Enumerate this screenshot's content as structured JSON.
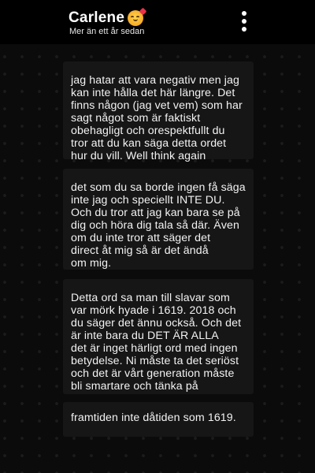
{
  "header": {
    "contact_name": "Carlene",
    "emoji_icon": "smiling-face-with-heart-icon",
    "status": "Mer än ett år sedan",
    "menu_icon": "more-vertical-icon"
  },
  "messages": [
    {
      "text": "jag hatar att vara negativ men jag\nkan inte hålla det här längre. Det\nfinns någon (jag vet vem) som har\nsagt något som är faktiskt\nobehagligt och orespektfullt du\ntror att du kan säga detta ordet\nhur du vill. Well think again"
    },
    {
      "text": "det som du sa borde ingen få säga\ninte jag och speciellt INTE DU.\nOch du tror att jag kan bara se på\ndig och höra dig tala så där. Även\nom du inte tror att säger det\ndirect åt mig så är det ändå\nom mig."
    },
    {
      "text": "Detta ord sa man till slavar som\nvar mörk hyade i 1619. 2018 och\ndu säger det ännu också. Och det\när inte bara du DET ÄR ALLA\ndet är inget härligt ord med ingen\nbetydelse. Ni måste ta det seriöst\noch det är vårt generation måste\nbli smartare och tänka på"
    },
    {
      "text": "framtiden inte dåtiden som 1619."
    }
  ]
}
